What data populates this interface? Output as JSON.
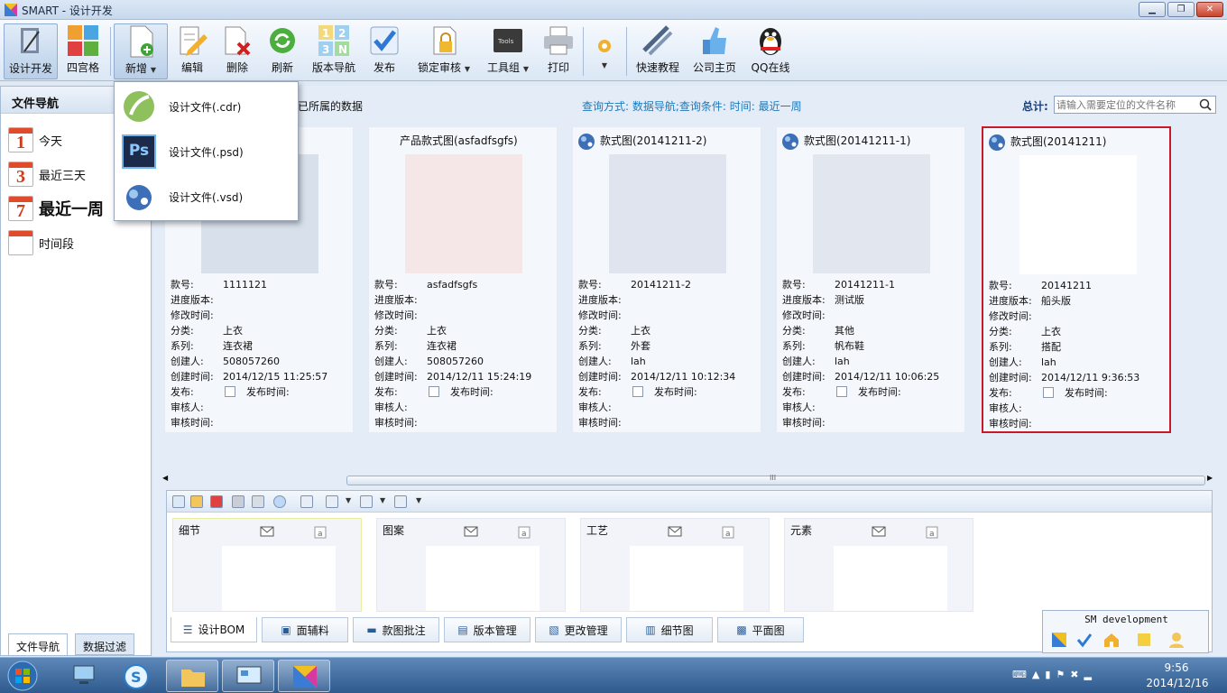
{
  "app": {
    "title": "SMART - 设计开发"
  },
  "toolbar": {
    "design_dev": "设计开发",
    "grid4": "四宫格",
    "add": "新增",
    "edit": "编辑",
    "delete": "删除",
    "refresh": "刷新",
    "version_nav": "版本导航",
    "publish": "发布",
    "lock_review": "锁定审核",
    "tools": "工具组",
    "print": "打印",
    "quick_tutorial": "快速教程",
    "company_home": "公司主页",
    "qq_online": "QQ在线"
  },
  "sidebar": {
    "title": "文件导航",
    "items": [
      {
        "num": "1",
        "label": "今天"
      },
      {
        "num": "3",
        "label": "最近三天"
      },
      {
        "num": "7",
        "label": "最近一周"
      },
      {
        "num": "",
        "label": "时间段"
      }
    ],
    "tabs": [
      "文件导航",
      "数据过滤"
    ]
  },
  "info": {
    "owned_data": "已所属的数据",
    "query": "查询方式: 数据导航;查询条件: 时间: 最近一周",
    "total_label": "总计:",
    "search_placeholder": "请输入需要定位的文件名称"
  },
  "dropdown": {
    "items": [
      "设计文件(.cdr)",
      "设计文件(.psd)",
      "设计文件(.vsd)"
    ],
    "ps_label": "Ps"
  },
  "field_labels": {
    "style_no": "款号:",
    "progress_version": "进度版本:",
    "modified_time": "修改时间:",
    "category": "分类:",
    "series": "系列:",
    "creator": "创建人:",
    "created_time": "创建时间:",
    "publish": "发布:",
    "publish_time": "发布时间:",
    "reviewer": "审核人:",
    "review_time": "审核时间:"
  },
  "cards": [
    {
      "title": "",
      "style_no": "1111121",
      "progress_version": "",
      "category": "上衣",
      "series": "连衣裙",
      "creator": "508057260",
      "created_time": "2014/12/15 11:25:57"
    },
    {
      "title": "产品款式图(asfadfsgfs)",
      "style_no": "asfadfsgfs",
      "progress_version": "",
      "category": "上衣",
      "series": "连衣裙",
      "creator": "508057260",
      "created_time": "2014/12/11 15:24:19"
    },
    {
      "title": "款式图(20141211-2)",
      "style_no": "20141211-2",
      "progress_version": "",
      "category": "上衣",
      "series": "外套",
      "creator": "lah",
      "created_time": "2014/12/11 10:12:34"
    },
    {
      "title": "款式图(20141211-1)",
      "style_no": "20141211-1",
      "progress_version": "测试版",
      "category": "其他",
      "series": "帆布鞋",
      "creator": "lah",
      "created_time": "2014/12/11 10:06:25"
    },
    {
      "title": "款式图(20141211)",
      "style_no": "20141211",
      "progress_version": "船头版",
      "category": "上衣",
      "series": "搭配",
      "creator": "lah",
      "created_time": "2014/12/11 9:36:53"
    }
  ],
  "bottom": {
    "thumbs": [
      "细节",
      "图案",
      "工艺",
      "元素"
    ],
    "tabs": [
      "设计BOM",
      "面辅料",
      "款图批注",
      "版本管理",
      "更改管理",
      "细节图",
      "平面图"
    ],
    "sm_title": "SM development",
    "scroll_grip": "III"
  },
  "taskbar": {
    "time": "9:56",
    "date": "2014/12/16"
  }
}
